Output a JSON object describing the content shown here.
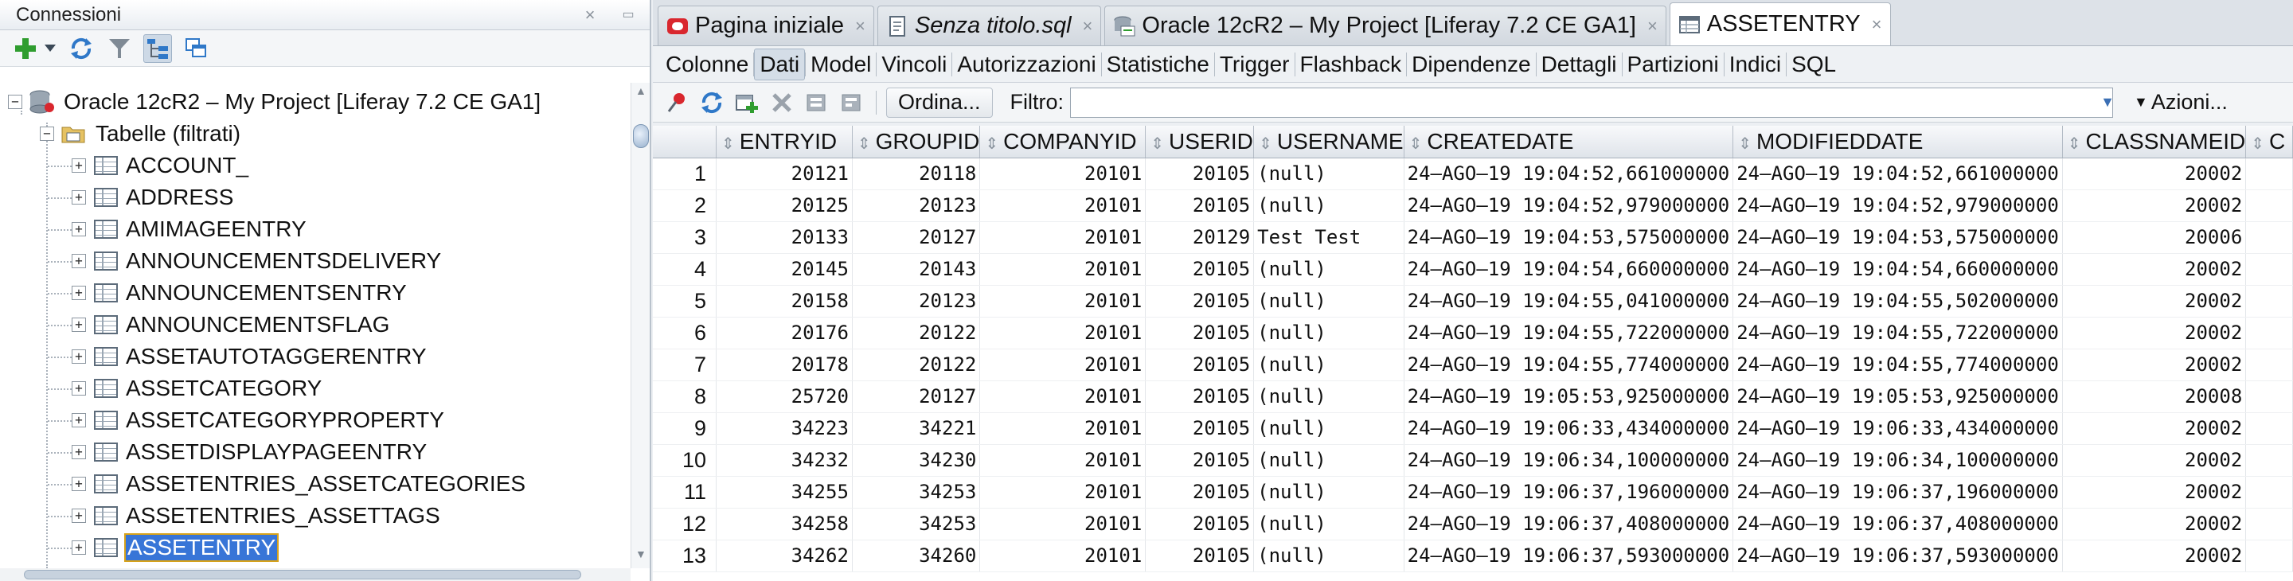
{
  "connections_panel": {
    "title": "Connessioni",
    "toolbar_icons": [
      "add-connection-icon",
      "dropdown-icon",
      "refresh-icon",
      "filter-icon",
      "schema-browser-icon",
      "reports-icon"
    ],
    "tree": {
      "root_label": "Oracle 12cR2 – My Project [Liferay 7.2 CE GA1]",
      "folder_label": "Tabelle (filtrati)",
      "tables": [
        "ACCOUNT_",
        "ADDRESS",
        "AMIMAGEENTRY",
        "ANNOUNCEMENTSDELIVERY",
        "ANNOUNCEMENTSENTRY",
        "ANNOUNCEMENTSFLAG",
        "ASSETAUTOTAGGERENTRY",
        "ASSETCATEGORY",
        "ASSETCATEGORYPROPERTY",
        "ASSETDISPLAYPAGEENTRY",
        "ASSETENTRIES_ASSETCATEGORIES",
        "ASSETENTRIES_ASSETTAGS",
        "ASSETENTRY"
      ],
      "selected": "ASSETENTRY"
    }
  },
  "editor_tabs": [
    {
      "label": "Pagina iniziale",
      "icon": "oracle-logo-icon",
      "italic": false,
      "active": false
    },
    {
      "label": "Senza titolo.sql",
      "icon": "sql-file-icon",
      "italic": true,
      "active": false
    },
    {
      "label": "Oracle 12cR2 – My Project [Liferay 7.2 CE GA1]",
      "icon": "sql-worksheet-icon",
      "italic": false,
      "active": false
    },
    {
      "label": "ASSETENTRY",
      "icon": "table-icon",
      "italic": false,
      "active": true
    }
  ],
  "object_tabs": [
    "Colonne",
    "Dati",
    "Model",
    "Vincoli",
    "Autorizzazioni",
    "Statistiche",
    "Trigger",
    "Flashback",
    "Dipendenze",
    "Dettagli",
    "Partizioni",
    "Indici",
    "SQL"
  ],
  "active_object_tab": "Dati",
  "grid_toolbar": {
    "sort_label": "Ordina...",
    "filter_label": "Filtro:",
    "filter_value": "",
    "actions_label": "Azioni..."
  },
  "grid": {
    "columns": [
      "ENTRYID",
      "GROUPID",
      "COMPANYID",
      "USERID",
      "USERNAME",
      "CREATEDATE",
      "MODIFIEDDATE",
      "CLASSNAMEID",
      "C"
    ],
    "rows": [
      [
        "1",
        "20121",
        "20118",
        "20101",
        "20105",
        "(null)",
        "24–AGO–19 19:04:52,661000000",
        "24–AGO–19 19:04:52,661000000",
        "20002"
      ],
      [
        "2",
        "20125",
        "20123",
        "20101",
        "20105",
        "(null)",
        "24–AGO–19 19:04:52,979000000",
        "24–AGO–19 19:04:52,979000000",
        "20002"
      ],
      [
        "3",
        "20133",
        "20127",
        "20101",
        "20129",
        "Test Test",
        "24–AGO–19 19:04:53,575000000",
        "24–AGO–19 19:04:53,575000000",
        "20006"
      ],
      [
        "4",
        "20145",
        "20143",
        "20101",
        "20105",
        "(null)",
        "24–AGO–19 19:04:54,660000000",
        "24–AGO–19 19:04:54,660000000",
        "20002"
      ],
      [
        "5",
        "20158",
        "20123",
        "20101",
        "20105",
        "(null)",
        "24–AGO–19 19:04:55,041000000",
        "24–AGO–19 19:04:55,502000000",
        "20002"
      ],
      [
        "6",
        "20176",
        "20122",
        "20101",
        "20105",
        "(null)",
        "24–AGO–19 19:04:55,722000000",
        "24–AGO–19 19:04:55,722000000",
        "20002"
      ],
      [
        "7",
        "20178",
        "20122",
        "20101",
        "20105",
        "(null)",
        "24–AGO–19 19:04:55,774000000",
        "24–AGO–19 19:04:55,774000000",
        "20002"
      ],
      [
        "8",
        "25720",
        "20127",
        "20101",
        "20105",
        "(null)",
        "24–AGO–19 19:05:53,925000000",
        "24–AGO–19 19:05:53,925000000",
        "20008"
      ],
      [
        "9",
        "34223",
        "34221",
        "20101",
        "20105",
        "(null)",
        "24–AGO–19 19:06:33,434000000",
        "24–AGO–19 19:06:33,434000000",
        "20002"
      ],
      [
        "10",
        "34232",
        "34230",
        "20101",
        "20105",
        "(null)",
        "24–AGO–19 19:06:34,100000000",
        "24–AGO–19 19:06:34,100000000",
        "20002"
      ],
      [
        "11",
        "34255",
        "34253",
        "20101",
        "20105",
        "(null)",
        "24–AGO–19 19:06:37,196000000",
        "24–AGO–19 19:06:37,196000000",
        "20002"
      ],
      [
        "12",
        "34258",
        "34253",
        "20101",
        "20105",
        "(null)",
        "24–AGO–19 19:06:37,408000000",
        "24–AGO–19 19:06:37,408000000",
        "20002"
      ],
      [
        "13",
        "34262",
        "34260",
        "20101",
        "20105",
        "(null)",
        "24–AGO–19 19:06:37,593000000",
        "24–AGO–19 19:06:37,593000000",
        "20002"
      ]
    ]
  },
  "colors": {
    "selection": "#3875d7",
    "oracle_red": "#d9272e",
    "add_green": "#2f9d2f",
    "refresh_blue": "#2f78c8"
  }
}
